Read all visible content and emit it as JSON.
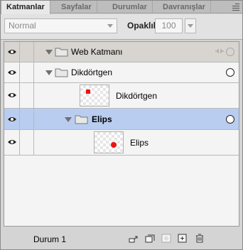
{
  "tabs": [
    {
      "label": "Katmanlar",
      "active": true
    },
    {
      "label": "Sayfalar",
      "active": false
    },
    {
      "label": "Durumlar",
      "active": false
    },
    {
      "label": "Davranışlar",
      "active": false
    }
  ],
  "options": {
    "blend_mode": "Normal",
    "opacity_label": "Opaklık",
    "opacity_value": "100"
  },
  "layers": [
    {
      "name": "Web Katmanı",
      "type": "web-folder",
      "expanded": true
    },
    {
      "name": "Dikdörtgen",
      "type": "folder",
      "expanded": true
    },
    {
      "name": "Dikdörtgen",
      "type": "object",
      "shape": "rectangle"
    },
    {
      "name": "Elips",
      "type": "folder",
      "expanded": true,
      "selected": true
    },
    {
      "name": "Elips",
      "type": "object",
      "shape": "ellipse"
    }
  ],
  "footer": {
    "state_label": "Durum 1"
  },
  "colors": {
    "selected_row": "#b9cdf0",
    "shape_fill": "#ee1111",
    "folder_header": "#d8d4cf"
  }
}
